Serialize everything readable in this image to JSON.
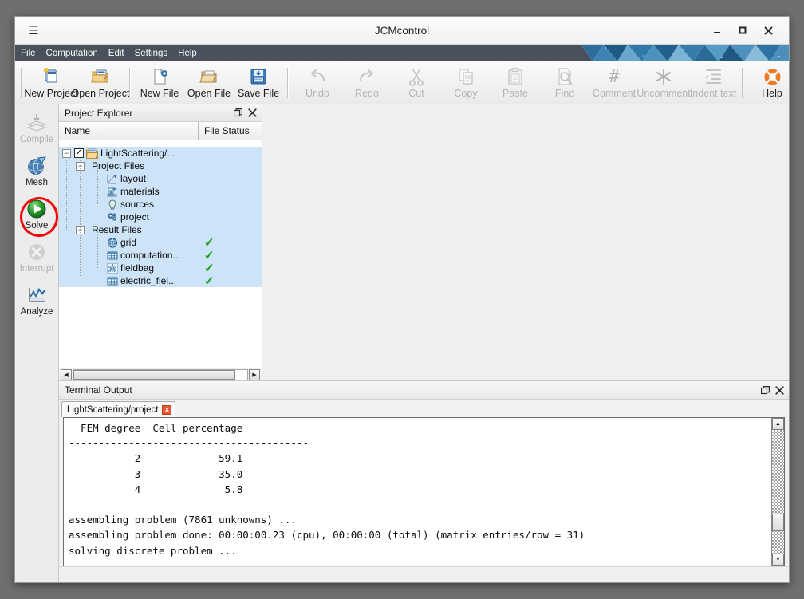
{
  "window": {
    "title": "JCMcontrol",
    "menu_icon": "hamburger-icon",
    "minimize": "minimize-icon",
    "maximize": "maximize-icon",
    "close": "close-icon"
  },
  "menubar": {
    "items": [
      {
        "pre": "",
        "key": "F",
        "post": "ile",
        "label": "File"
      },
      {
        "pre": "",
        "key": "C",
        "post": "omputation",
        "label": "Computation"
      },
      {
        "pre": "",
        "key": "E",
        "post": "dit",
        "label": "Edit"
      },
      {
        "pre": "",
        "key": "S",
        "post": "ettings",
        "label": "Settings"
      },
      {
        "pre": "",
        "key": "H",
        "post": "elp",
        "label": "Help"
      }
    ]
  },
  "toolbar": {
    "groups": [
      {
        "items": [
          {
            "label": "New Project",
            "icon": "new-project-icon",
            "enabled": true
          },
          {
            "label": "Open Project",
            "icon": "open-project-icon",
            "enabled": true
          }
        ]
      },
      {
        "items": [
          {
            "label": "New File",
            "icon": "new-file-icon",
            "enabled": true
          },
          {
            "label": "Open File",
            "icon": "open-file-icon",
            "enabled": true
          },
          {
            "label": "Save File",
            "icon": "save-file-icon",
            "enabled": true
          }
        ]
      },
      {
        "items": [
          {
            "label": "Undo",
            "icon": "undo-icon",
            "enabled": false
          },
          {
            "label": "Redo",
            "icon": "redo-icon",
            "enabled": false
          },
          {
            "label": "Cut",
            "icon": "cut-icon",
            "enabled": false
          },
          {
            "label": "Copy",
            "icon": "copy-icon",
            "enabled": false
          },
          {
            "label": "Paste",
            "icon": "paste-icon",
            "enabled": false
          },
          {
            "label": "Find",
            "icon": "find-icon",
            "enabled": false
          },
          {
            "label": "Comment",
            "icon": "comment-icon",
            "enabled": false
          },
          {
            "label": "Uncomment",
            "icon": "uncomment-icon",
            "enabled": false
          },
          {
            "label": "Indent text",
            "icon": "indent-text-icon",
            "enabled": false
          }
        ]
      },
      {
        "items": [
          {
            "label": "Help",
            "icon": "help-lifebuoy-icon",
            "enabled": true
          }
        ]
      }
    ]
  },
  "actionbar": {
    "items": [
      {
        "label": "Compile",
        "icon": "compile-stack-icon",
        "enabled": false,
        "highlighted": false
      },
      {
        "label": "Mesh",
        "icon": "mesh-globe-icon",
        "enabled": true,
        "highlighted": false
      },
      {
        "label": "Solve",
        "icon": "solve-play-icon",
        "enabled": true,
        "highlighted": true
      },
      {
        "label": "Interrupt",
        "icon": "interrupt-cross-icon",
        "enabled": false,
        "highlighted": false
      },
      {
        "label": "Analyze",
        "icon": "analyze-chart-icon",
        "enabled": true,
        "highlighted": false
      }
    ],
    "highlight_color": "#f50505"
  },
  "project_explorer": {
    "title": "Project Explorer",
    "float_icon": "float-panel-icon",
    "close_icon": "close-panel-icon",
    "columns": [
      "Name",
      "File Status"
    ],
    "tree": [
      {
        "label": "LightScattering/...",
        "depth": 0,
        "type": "project-root",
        "icon": "folder-icon",
        "expander": "-",
        "checkbox": true,
        "checked": true,
        "status": "",
        "selected": true
      },
      {
        "label": "Project Files",
        "depth": 1,
        "type": "group",
        "icon": "",
        "expander": "-",
        "checkbox": false,
        "status": "",
        "selected": true
      },
      {
        "label": "layout",
        "depth": 2,
        "type": "file",
        "icon": "layout-icon",
        "expander": "",
        "checkbox": false,
        "status": "",
        "selected": true
      },
      {
        "label": "materials",
        "depth": 2,
        "type": "file",
        "icon": "materials-icon",
        "expander": "",
        "checkbox": false,
        "status": "",
        "selected": true
      },
      {
        "label": "sources",
        "depth": 2,
        "type": "file",
        "icon": "sources-bulb-icon",
        "expander": "",
        "checkbox": false,
        "status": "",
        "selected": true
      },
      {
        "label": "project",
        "depth": 2,
        "type": "file",
        "icon": "project-gears-icon",
        "expander": "",
        "checkbox": false,
        "status": "",
        "selected": true
      },
      {
        "label": "Result Files",
        "depth": 1,
        "type": "group",
        "icon": "",
        "expander": "-",
        "checkbox": false,
        "status": "",
        "selected": true
      },
      {
        "label": "grid",
        "depth": 2,
        "type": "file",
        "icon": "grid-sphere-icon",
        "expander": "",
        "checkbox": false,
        "status": "check",
        "selected": true
      },
      {
        "label": "computation...",
        "depth": 2,
        "type": "file",
        "icon": "table-icon",
        "expander": "",
        "checkbox": false,
        "status": "check",
        "selected": true
      },
      {
        "label": "fieldbag",
        "depth": 2,
        "type": "file",
        "icon": "fieldbag-icon",
        "expander": "",
        "checkbox": false,
        "status": "check",
        "selected": true
      },
      {
        "label": "electric_fiel...",
        "depth": 2,
        "type": "file",
        "icon": "table-icon",
        "expander": "",
        "checkbox": false,
        "status": "check",
        "selected": true
      }
    ],
    "status_ok_color": "#13a013",
    "selection_color": "#cde3f7",
    "hscroll": {
      "left_arrow": "◀",
      "right_arrow": "▶"
    }
  },
  "terminal": {
    "title": "Terminal Output",
    "float_icon": "float-panel-icon",
    "close_icon": "close-panel-icon",
    "tabs": [
      {
        "label": "LightScattering/project",
        "active": true,
        "close": "x"
      }
    ],
    "lines": [
      "  FEM degree  Cell percentage",
      "----------------------------------------",
      "           2             59.1",
      "           3             35.0",
      "           4              5.8",
      "",
      "assembling problem (7861 unknowns) ...",
      "assembling problem done: 00:00:00.23 (cpu), 00:00:00 (total) (matrix entries/row = 31)",
      "solving discrete problem ..."
    ],
    "scroll_up": "▲",
    "scroll_down": "▼"
  }
}
